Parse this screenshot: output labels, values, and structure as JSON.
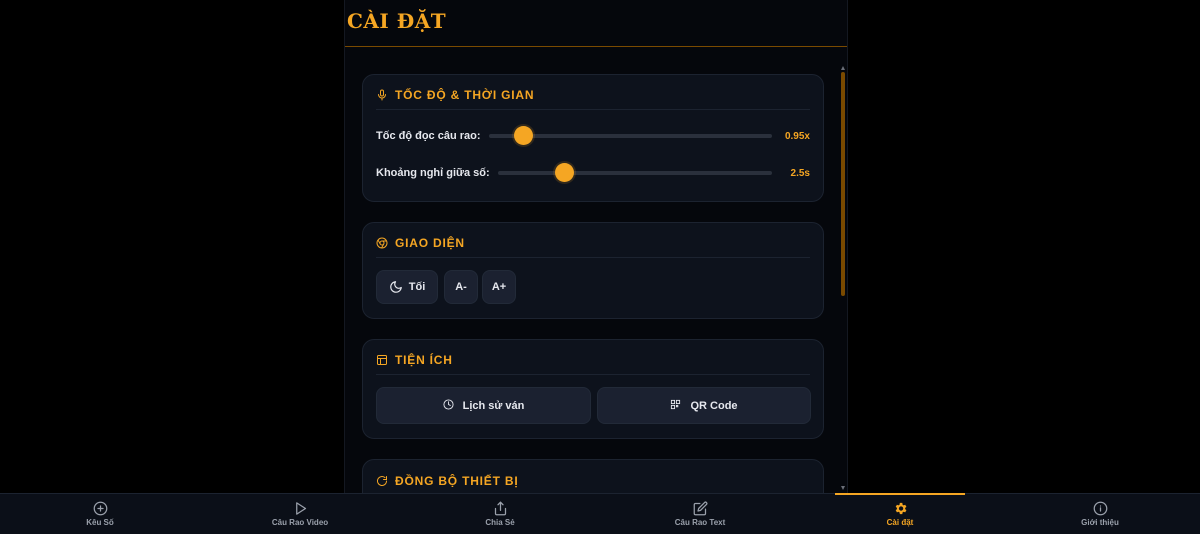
{
  "page": {
    "title": "CÀI ĐẶT"
  },
  "colors": {
    "accent": "#f5a623",
    "card_bg": "#0d121c",
    "panel_bg": "#05070c",
    "button_bg": "#1b2130"
  },
  "speed_card": {
    "title": "TỐC ĐỘ & THỜI GIAN",
    "icon": "microphone-icon",
    "read_speed": {
      "label": "Tốc độ đọc câu rao:",
      "value_text": "0.95x",
      "position_fraction": 0.12
    },
    "pause": {
      "label": "Khoảng nghỉ giữa số:",
      "value_text": "2.5s",
      "position_fraction": 0.24
    }
  },
  "appearance_card": {
    "title": "GIAO DIỆN",
    "icon": "palette-icon",
    "theme_button": {
      "label": "Tối",
      "icon": "moon-icon"
    },
    "font_smaller": "A-",
    "font_larger": "A+"
  },
  "utilities_card": {
    "title": "TIỆN ÍCH",
    "icon": "layout-icon",
    "history_button": {
      "label": "Lịch sử ván",
      "icon": "clock-icon"
    },
    "qr_button": {
      "label": "QR Code",
      "icon": "qr-code-icon"
    }
  },
  "sync_card": {
    "title": "ĐỒNG BỘ THIẾT BỊ",
    "icon": "refresh-icon"
  },
  "bottom_nav": [
    {
      "label": "Kêu Số",
      "icon": "plus-circle-icon",
      "active": false
    },
    {
      "label": "Câu Rao Video",
      "icon": "play-icon",
      "active": false
    },
    {
      "label": "Chia Sẻ",
      "icon": "share-icon",
      "active": false
    },
    {
      "label": "Câu Rao Text",
      "icon": "edit-icon",
      "active": false
    },
    {
      "label": "Cài đặt",
      "icon": "gear-icon",
      "active": true
    },
    {
      "label": "Giới thiệu",
      "icon": "info-icon",
      "active": false
    }
  ]
}
